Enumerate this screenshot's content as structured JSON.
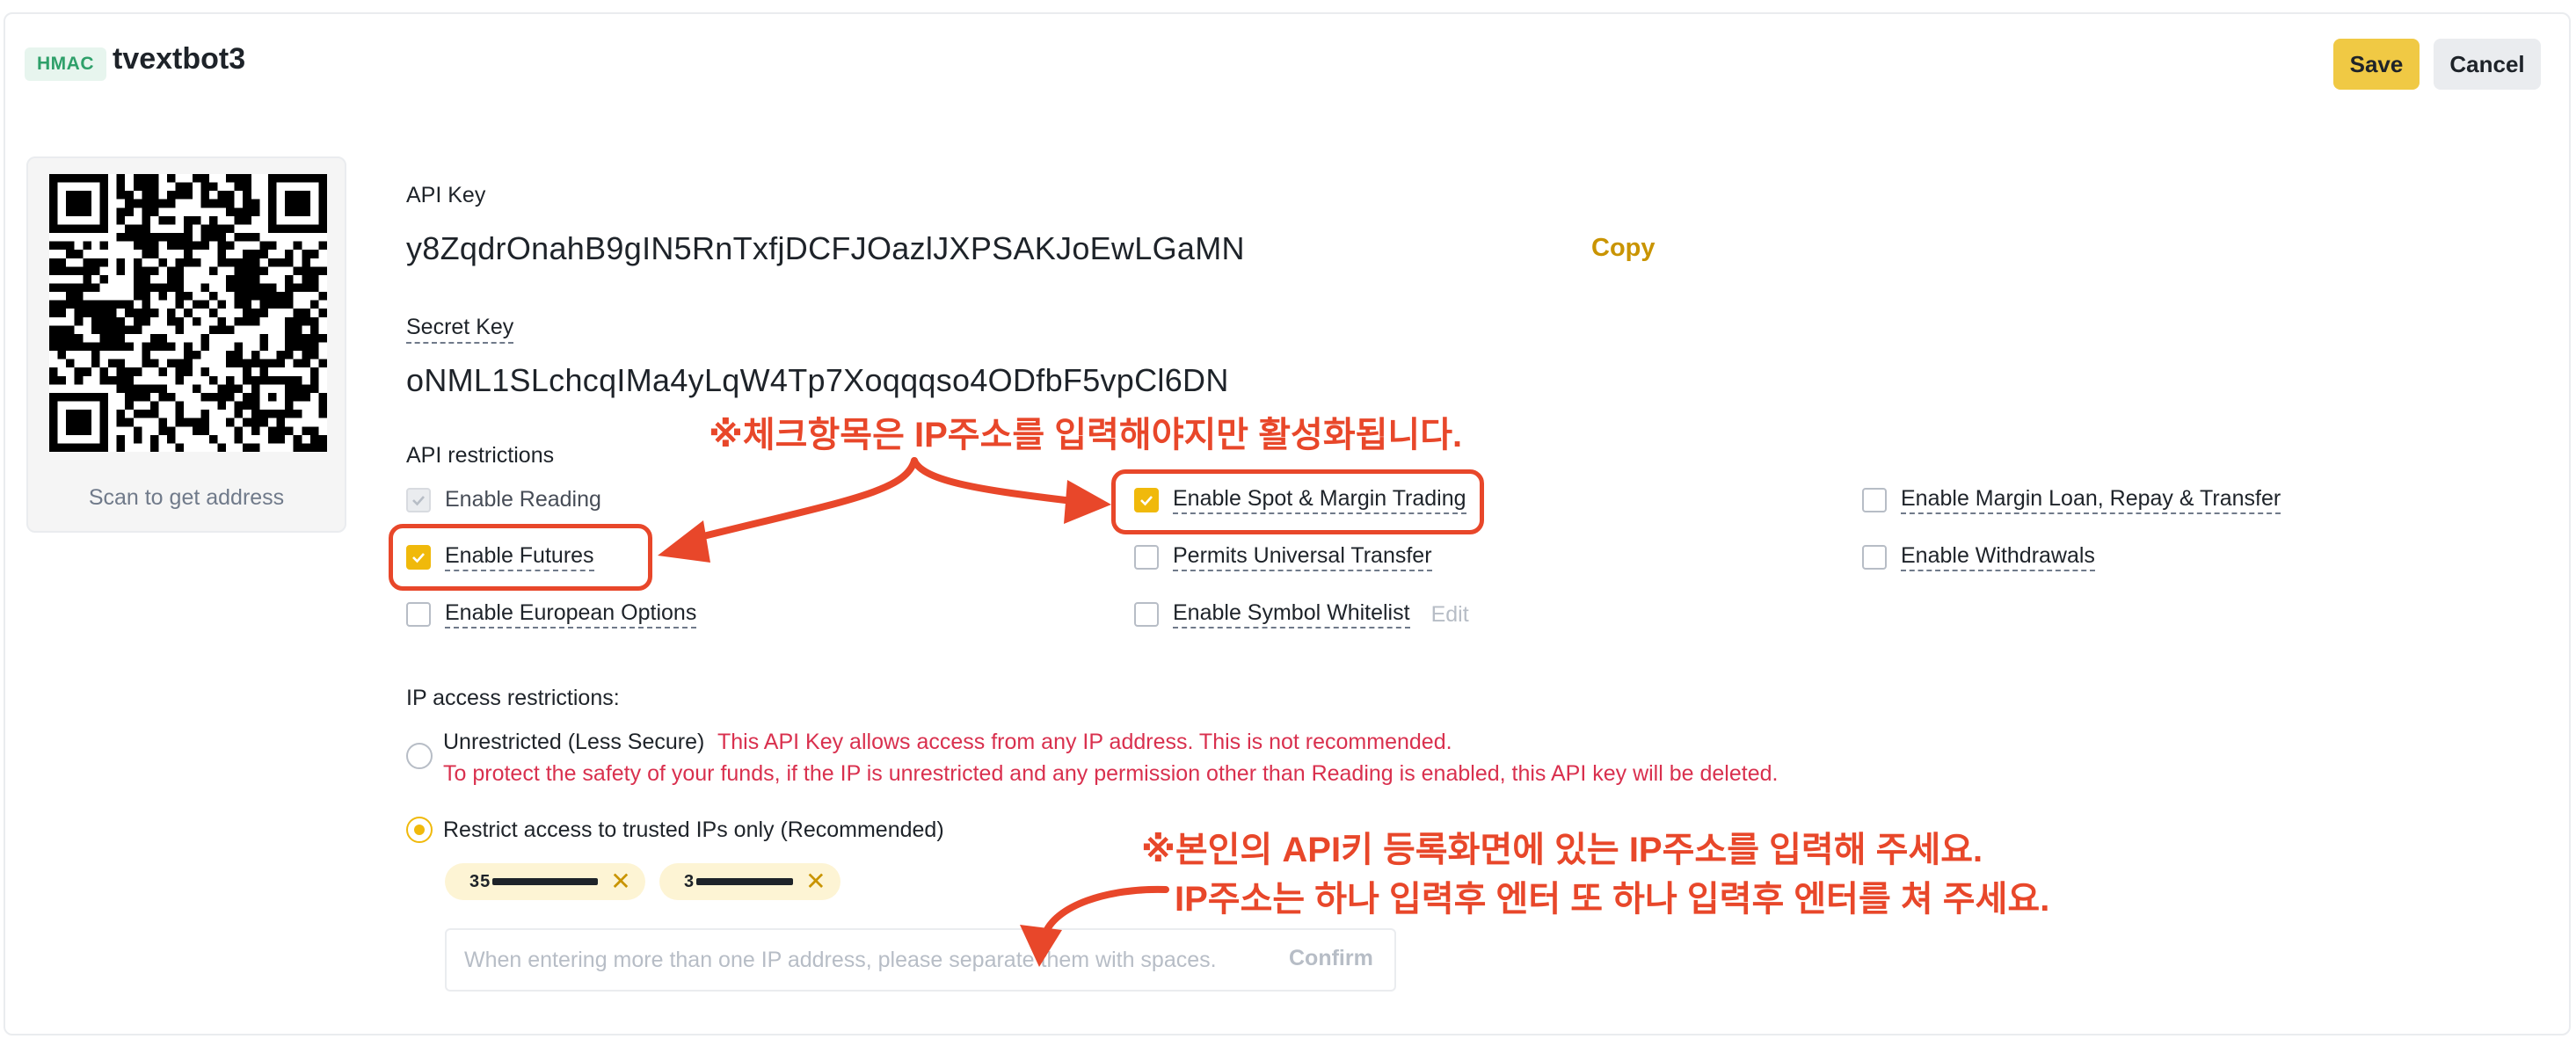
{
  "header": {
    "badge": "HMAC",
    "key_name": "tvextbot3",
    "save_label": "Save",
    "cancel_label": "Cancel"
  },
  "qr": {
    "caption": "Scan to get address"
  },
  "api_key": {
    "label": "API Key",
    "value": "y8ZqdrOnahB9gIN5RnTxfjDCFJOazlJXPSAKJoEwLGaMN",
    "copy_label": "Copy"
  },
  "secret_key": {
    "label": "Secret Key",
    "value": "oNML1SLchcqIMa4yLqW4Tp7Xoqqqso4ODfbF5vpCl6DN"
  },
  "restrictions": {
    "label": "API restrictions",
    "items": [
      {
        "label": "Enable Reading",
        "checked": true,
        "disabled": true
      },
      {
        "label": "Enable Spot & Margin Trading",
        "checked": true
      },
      {
        "label": "Enable Margin Loan, Repay & Transfer",
        "checked": false
      },
      {
        "label": "Enable Futures",
        "checked": true
      },
      {
        "label": "Permits Universal Transfer",
        "checked": false
      },
      {
        "label": "Enable Withdrawals",
        "checked": false
      },
      {
        "label": "Enable European Options",
        "checked": false
      },
      {
        "label": "Enable Symbol Whitelist",
        "checked": false
      }
    ],
    "edit_label": "Edit"
  },
  "ip_access": {
    "label": "IP access restrictions:",
    "unrestricted_label": "Unrestricted (Less Secure)",
    "unrestricted_warning_1": "This API Key allows access from any IP address. This is not recommended.",
    "unrestricted_warning_2": "To protect the safety of your funds, if the IP is unrestricted and any permission other than Reading is enabled, this API key will be deleted.",
    "restricted_label": "Restrict access to trusted IPs only (Recommended)",
    "selected": "restricted",
    "ip_tags": [
      "35",
      "3"
    ],
    "input_placeholder": "When entering more than one IP address, please separate them with spaces.",
    "confirm_label": "Confirm"
  },
  "annotations": {
    "note_top": "※체크항목은 IP주소를 입력해야지만 활성화됩니다.",
    "note_bottom_1": "※본인의 API키 등록화면에 있는 IP주소를 입력해 주세요.",
    "note_bottom_2": "IP주소는 하나 입력후 엔터 또 하나 입력후 엔터를 쳐 주세요.",
    "color": "#e8472a"
  },
  "colors": {
    "accent": "#f0b90b",
    "save_button": "#f0c944",
    "warning": "#d9304e",
    "copy_link": "#c99400"
  }
}
